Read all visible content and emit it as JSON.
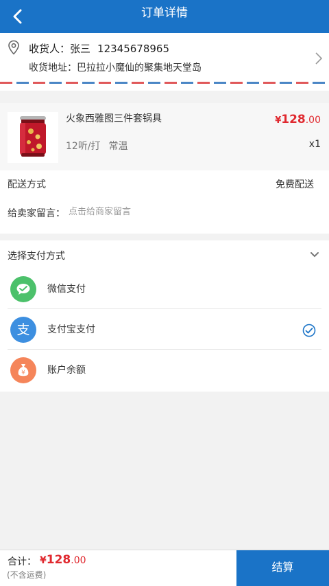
{
  "header": {
    "title": "订单详情",
    "back_icon": "chevron-left-icon"
  },
  "address": {
    "recipient_label": "收货人：",
    "recipient_name": "张三",
    "phone": "12345678965",
    "address_label": "收货地址：",
    "address_value": "巴拉拉小魔仙的聚集地天堂岛",
    "icons": [
      "location-pin-icon",
      "chevron-right-icon"
    ]
  },
  "product": {
    "name": "火象西雅图三件套锅具",
    "spec_1": "12听/打",
    "spec_2": "常温",
    "price_symbol": "¥",
    "price_int": "128",
    "price_dec": ".00",
    "quantity": "x1"
  },
  "delivery": {
    "method_label": "配送方式",
    "method_value": "免费配送",
    "message_label": "给卖家留言：",
    "message_placeholder": "点击给商家留言",
    "message_value": ""
  },
  "payment": {
    "title": "选择支付方式",
    "options": [
      {
        "label": "微信支付",
        "icon": "wechat-pay-icon",
        "color": "#4cc16b",
        "selected": false
      },
      {
        "label": "支付宝支付",
        "icon": "alipay-icon",
        "color": "#3d8fe0",
        "selected": true
      },
      {
        "label": "账户余额",
        "icon": "money-bag-icon",
        "color": "#f5855a",
        "selected": false
      }
    ]
  },
  "footer": {
    "total_label": "合计：",
    "total_symbol": "¥",
    "total_int": "128",
    "total_dec": ".00",
    "shipping_note": "(不含运费)",
    "checkout_label": "结算"
  },
  "colors": {
    "primary": "#1a73c7",
    "price": "#e0292f",
    "check": "#1a73c7"
  }
}
